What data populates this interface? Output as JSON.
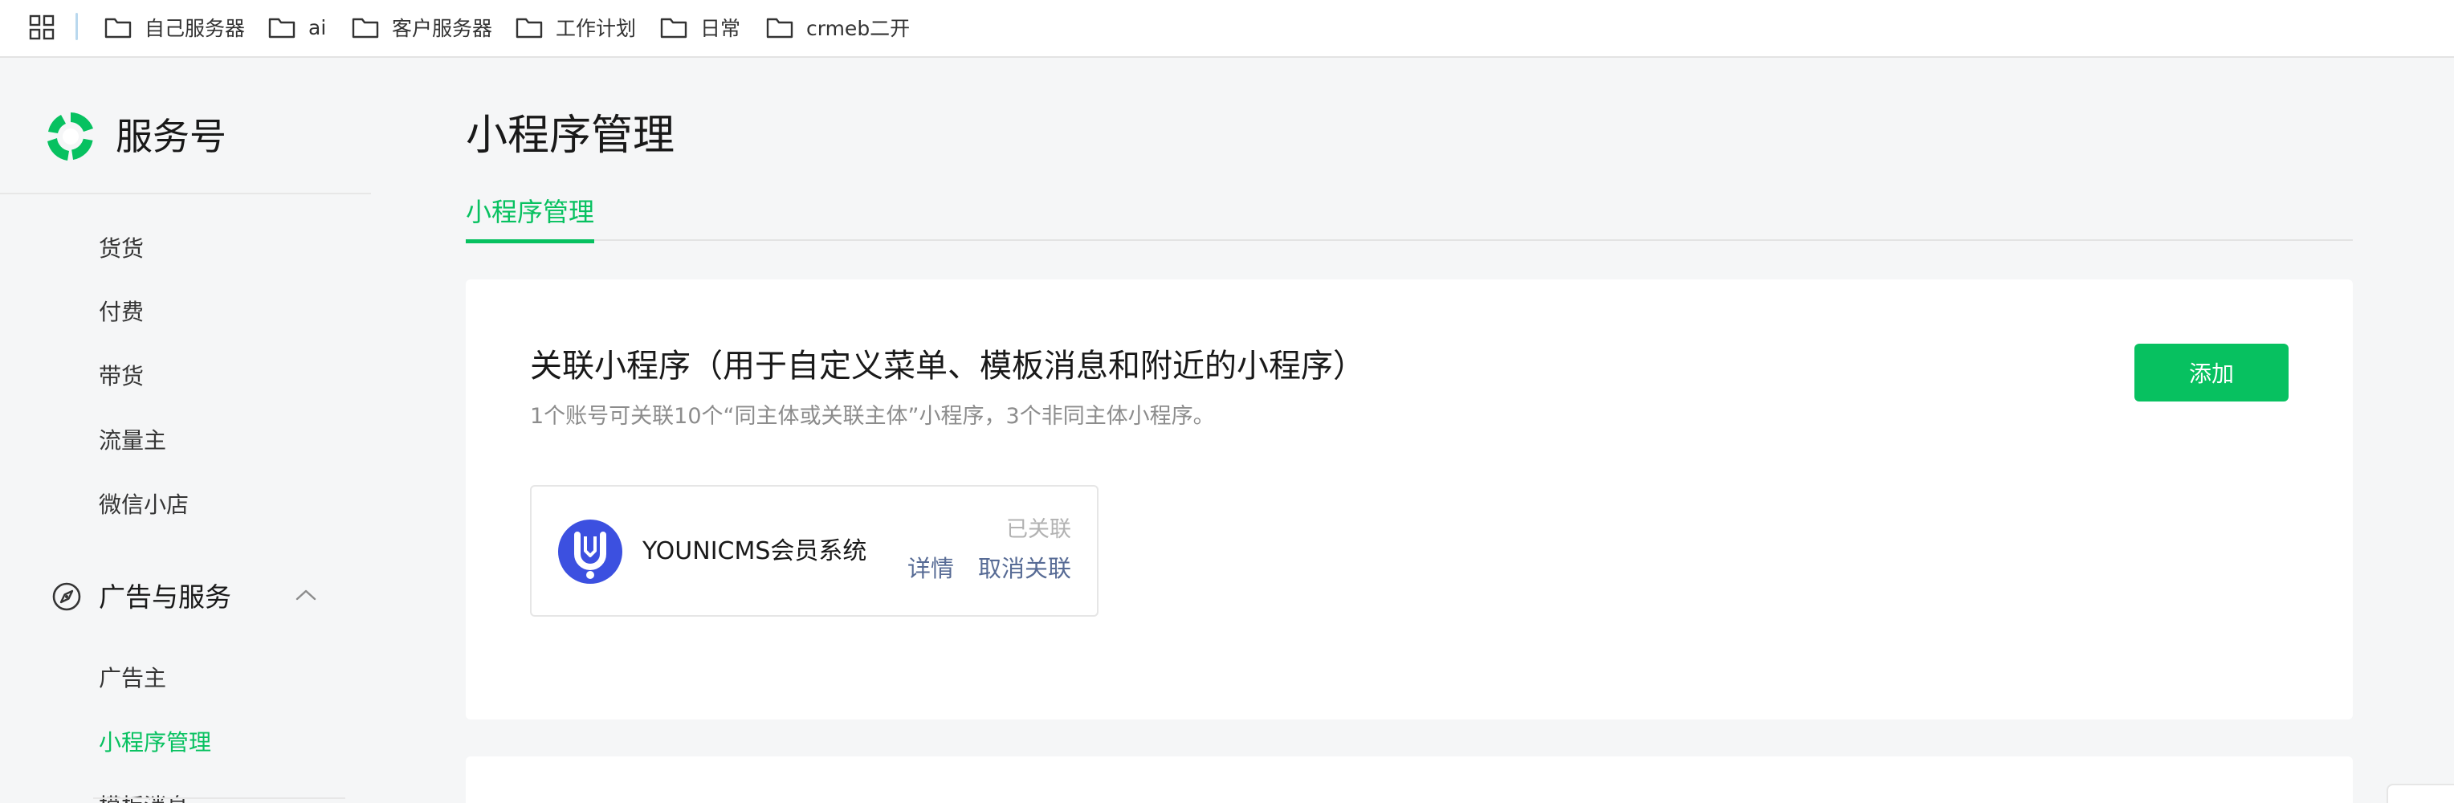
{
  "bookmarks": [
    {
      "label": "自己服务器"
    },
    {
      "label": "ai"
    },
    {
      "label": "客户服务器"
    },
    {
      "label": "工作计划"
    },
    {
      "label": "日常"
    },
    {
      "label": "crmeb二开"
    }
  ],
  "sidebar": {
    "brand": "服务号",
    "items_top": [
      {
        "label": "货货"
      },
      {
        "label": "付费"
      },
      {
        "label": "带货"
      },
      {
        "label": "流量主"
      },
      {
        "label": "微信小店"
      }
    ],
    "group": {
      "label": "广告与服务",
      "icon": "compass-icon",
      "expanded": true
    },
    "group_items": [
      {
        "label": "广告主"
      },
      {
        "label": "小程序管理",
        "active": true
      },
      {
        "label": "模板消息"
      }
    ]
  },
  "main": {
    "title": "小程序管理",
    "tabs": [
      {
        "label": "小程序管理",
        "active": true
      }
    ],
    "section": {
      "title": "关联小程序（用于自定义菜单、模板消息和附近的小程序）",
      "desc": "1个账号可关联10个“同主体或关联主体”小程序，3个非同主体小程序。",
      "add_label": "添加"
    },
    "mini_program": {
      "name": "YOUNICMS会员系统",
      "status": "已关联",
      "detail_label": "详情",
      "unlink_label": "取消关联"
    }
  },
  "colors": {
    "accent": "#07c160",
    "link": "#576b95",
    "avatar": "#3c50e0"
  }
}
